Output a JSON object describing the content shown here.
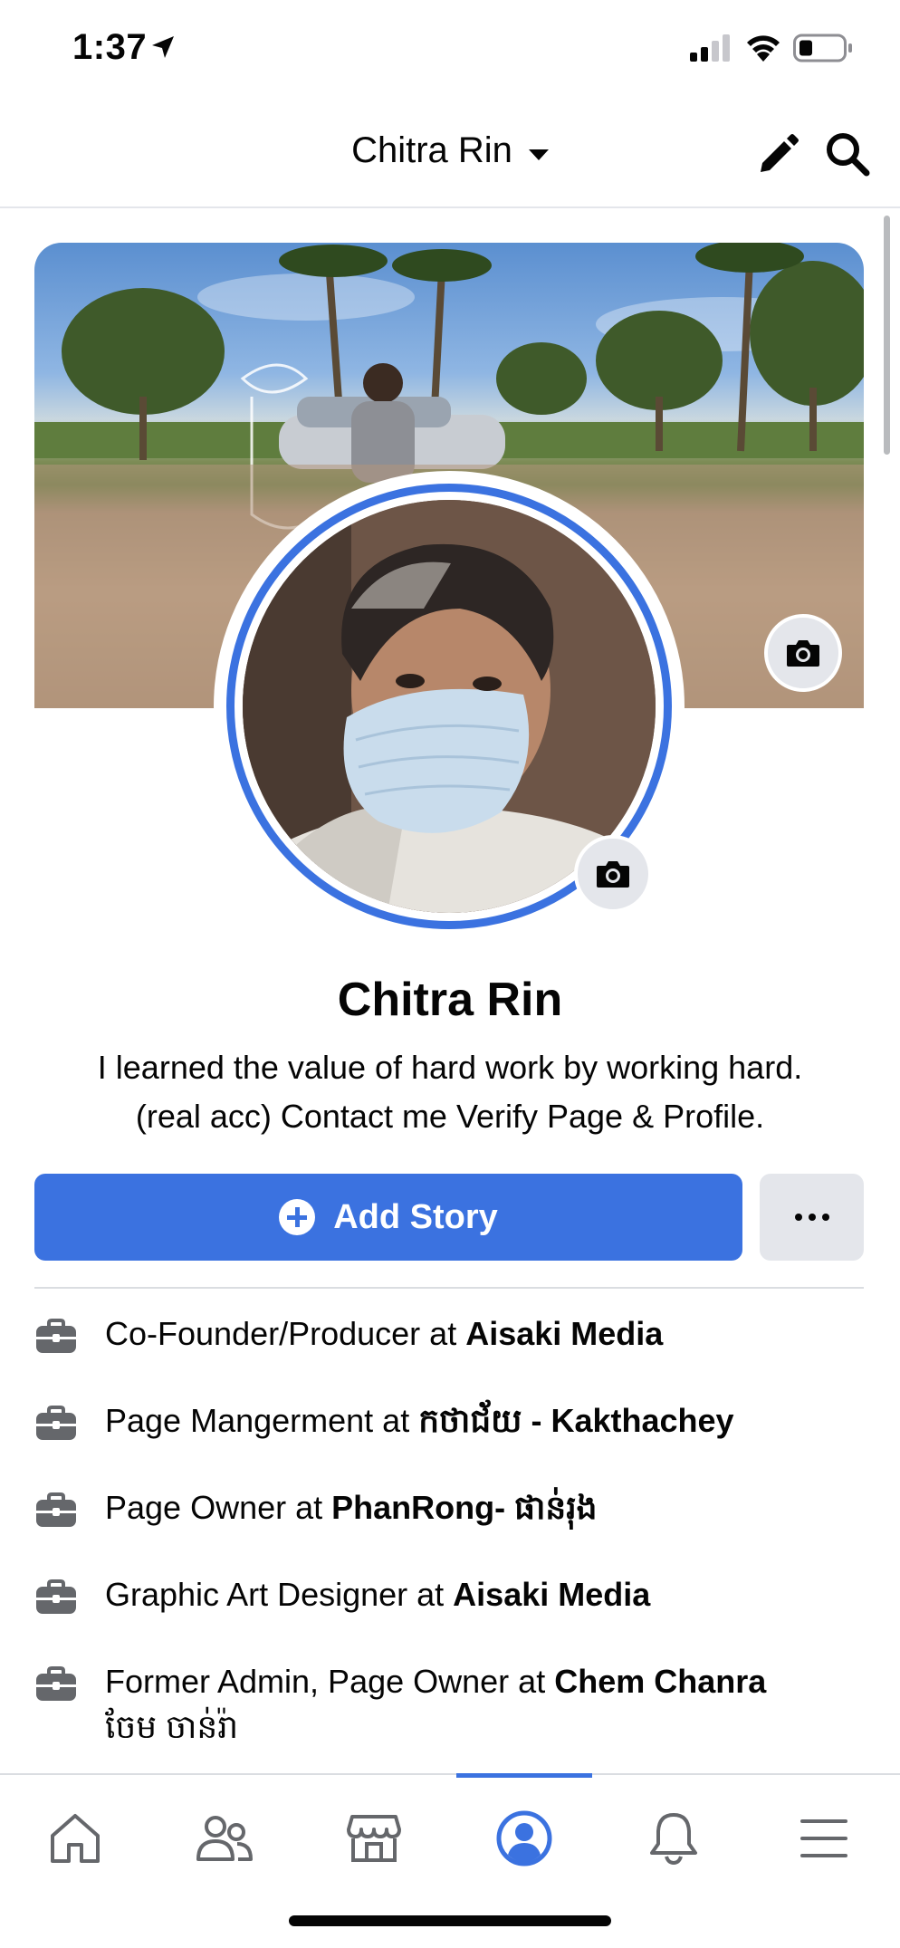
{
  "status_bar": {
    "time": "1:37"
  },
  "header": {
    "title": "Chitra Rin"
  },
  "profile": {
    "name": "Chitra Rin",
    "bio_line1": "I learned the value of hard work by working hard.",
    "bio_line2": "(real acc) Contact me Verify Page & Profile."
  },
  "actions": {
    "add_story_label": "Add Story"
  },
  "work": [
    {
      "role": "Co-Founder/Producer at ",
      "org": "Aisaki Media"
    },
    {
      "role": "Page Mangerment at ",
      "org": "កថាជ័យ - Kakthachey"
    },
    {
      "role": "Page Owner at ",
      "org": "PhanRong- ផាន់រុង"
    },
    {
      "role": "Graphic Art Designer at ",
      "org": "Aisaki Media"
    },
    {
      "role": "Former Admin, Page Owner at ",
      "org": "Chem Chanra",
      "org_line2": "ចែម ចាន់រ៉ា"
    }
  ],
  "tabs": [
    {
      "icon": "home-icon"
    },
    {
      "icon": "friends-icon"
    },
    {
      "icon": "marketplace-icon"
    },
    {
      "icon": "profile-icon",
      "active": true
    },
    {
      "icon": "bell-icon"
    },
    {
      "icon": "menu-icon"
    }
  ],
  "colors": {
    "accent": "#3b72e0",
    "button_gray": "#e4e6eb",
    "text": "#050505"
  }
}
